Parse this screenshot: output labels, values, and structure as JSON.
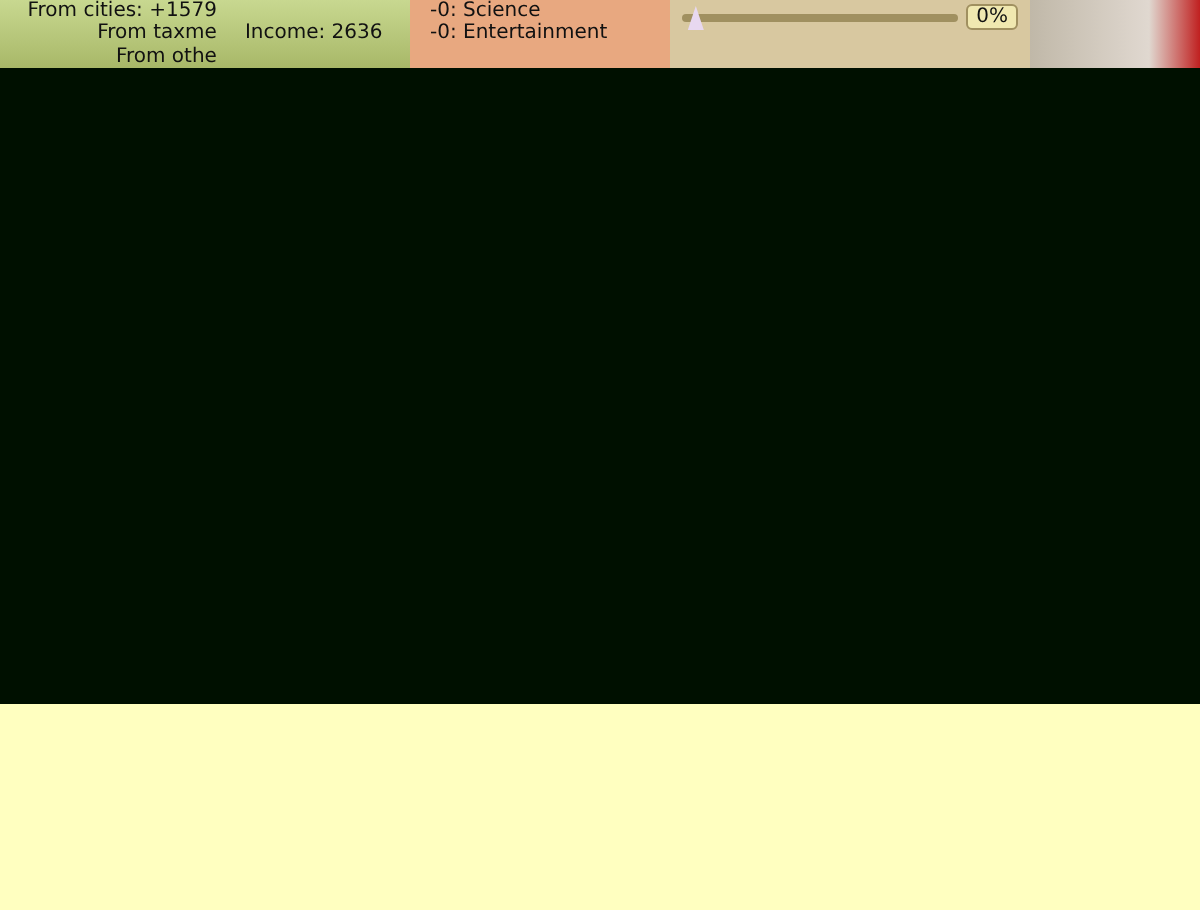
{
  "finance": {
    "lines": [
      "From cities: +1579",
      "From taxme",
      "From othe"
    ],
    "income": "Income: 2636"
  },
  "spending": {
    "lines": [
      "-0: Science",
      "-0: Entertainment"
    ]
  },
  "slider": {
    "level": 0.05,
    "reading": "0%"
  }
}
